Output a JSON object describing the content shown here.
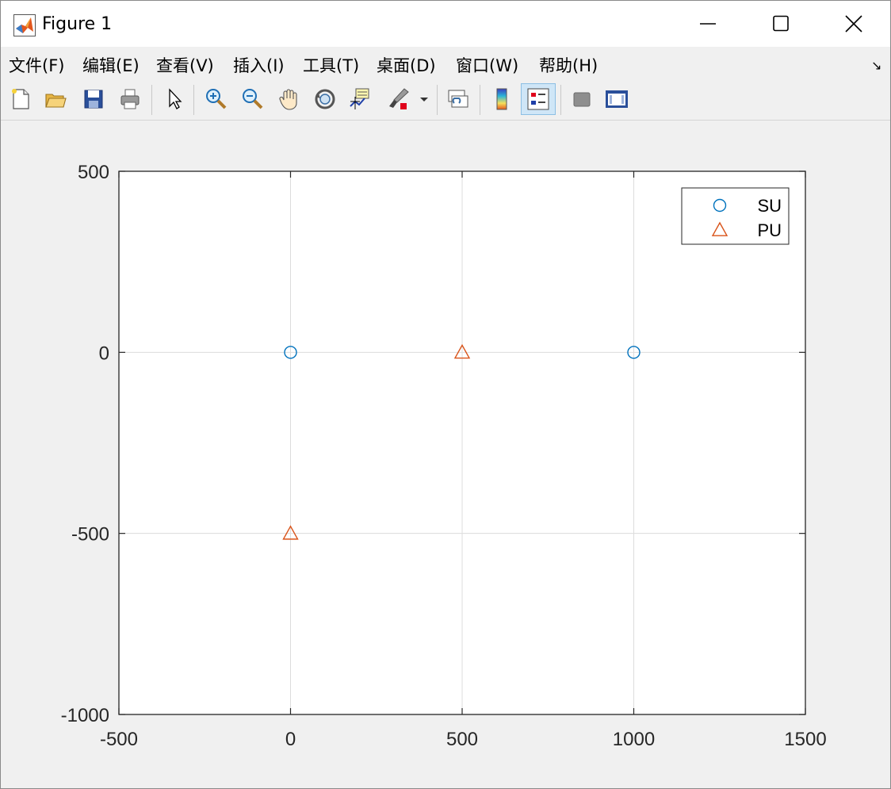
{
  "window": {
    "title": "Figure 1"
  },
  "menu": [
    {
      "label": "文件(F)",
      "key": "file"
    },
    {
      "label": "编辑(E)",
      "key": "edit"
    },
    {
      "label": "查看(V)",
      "key": "view"
    },
    {
      "label": "插入(I)",
      "key": "insert"
    },
    {
      "label": "工具(T)",
      "key": "tools"
    },
    {
      "label": "桌面(D)",
      "key": "desktop"
    },
    {
      "label": "窗口(W)",
      "key": "window"
    },
    {
      "label": "帮助(H)",
      "key": "help"
    }
  ],
  "toolbar": [
    {
      "icon": "new-figure-icon"
    },
    {
      "icon": "open-file-icon"
    },
    {
      "icon": "save-icon"
    },
    {
      "icon": "print-icon"
    },
    {
      "icon": "select-pointer-icon"
    },
    {
      "icon": "zoom-in-icon"
    },
    {
      "icon": "zoom-out-icon"
    },
    {
      "icon": "pan-hand-icon"
    },
    {
      "icon": "rotate-3d-icon"
    },
    {
      "icon": "data-cursor-icon"
    },
    {
      "icon": "brush-icon"
    },
    {
      "icon": "link-plot-icon"
    },
    {
      "icon": "colorbar-icon"
    },
    {
      "icon": "legend-icon",
      "active": true
    },
    {
      "icon": "hide-plot-tools-icon"
    },
    {
      "icon": "show-plot-tools-icon"
    }
  ],
  "colors": {
    "su": "#0072BD",
    "pu": "#D95319",
    "grid": "#dcdcdc"
  },
  "chart_data": {
    "type": "scatter",
    "xlim": [
      -500,
      1500
    ],
    "ylim": [
      -1000,
      500
    ],
    "xticks": [
      -500,
      0,
      500,
      1000,
      1500
    ],
    "yticks": [
      500,
      0,
      -500,
      -1000
    ],
    "grid": true,
    "legend_position": "top-right",
    "series": [
      {
        "name": "SU",
        "marker": "circle",
        "color": "#0072BD",
        "points": [
          [
            0,
            0
          ],
          [
            1000,
            0
          ]
        ]
      },
      {
        "name": "PU",
        "marker": "triangle",
        "color": "#D95319",
        "points": [
          [
            500,
            0
          ],
          [
            0,
            -500
          ]
        ]
      }
    ]
  }
}
